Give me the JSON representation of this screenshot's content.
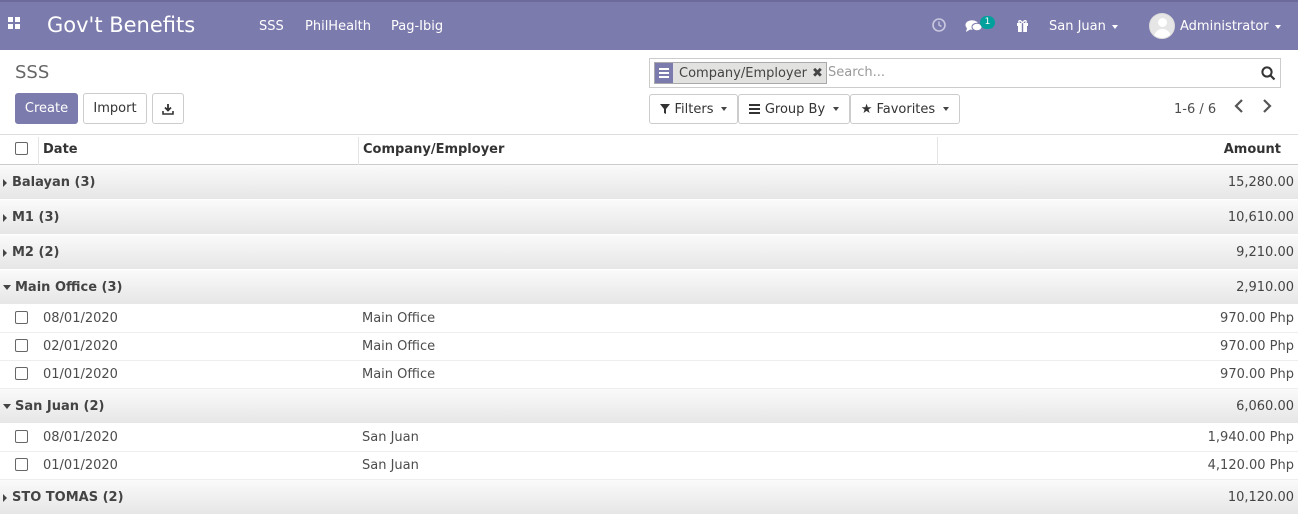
{
  "navbar": {
    "brand": "Gov't Benefits",
    "menu": [
      "SSS",
      "PhilHealth",
      "Pag-Ibig"
    ],
    "message_count": "1",
    "company": "San Juan",
    "user": "Administrator"
  },
  "control_panel": {
    "breadcrumb": "SSS",
    "create_label": "Create",
    "import_label": "Import",
    "facet_label": "Company/Employer",
    "search_placeholder": "Search...",
    "filters_label": "Filters",
    "groupby_label": "Group By",
    "favorites_label": "Favorites",
    "pager": "1-6 / 6"
  },
  "table": {
    "headers": {
      "date": "Date",
      "company": "Company/Employer",
      "amount": "Amount"
    },
    "groups": [
      {
        "name": "Balayan (3)",
        "total": "15,280.00",
        "expanded": false,
        "rows": []
      },
      {
        "name": "M1 (3)",
        "total": "10,610.00",
        "expanded": false,
        "rows": []
      },
      {
        "name": "M2 (2)",
        "total": "9,210.00",
        "expanded": false,
        "rows": []
      },
      {
        "name": "Main Office (3)",
        "total": "2,910.00",
        "expanded": true,
        "rows": [
          {
            "date": "08/01/2020",
            "company": "Main Office",
            "amount": "970.00 Php"
          },
          {
            "date": "02/01/2020",
            "company": "Main Office",
            "amount": "970.00 Php"
          },
          {
            "date": "01/01/2020",
            "company": "Main Office",
            "amount": "970.00 Php"
          }
        ]
      },
      {
        "name": "San Juan (2)",
        "total": "6,060.00",
        "expanded": true,
        "rows": [
          {
            "date": "08/01/2020",
            "company": "San Juan",
            "amount": "1,940.00 Php"
          },
          {
            "date": "01/01/2020",
            "company": "San Juan",
            "amount": "4,120.00 Php"
          }
        ]
      },
      {
        "name": "STO TOMAS (2)",
        "total": "10,120.00",
        "expanded": false,
        "rows": []
      }
    ]
  },
  "colors": {
    "brand": "#7c7bad",
    "badge": "#00a09d"
  }
}
